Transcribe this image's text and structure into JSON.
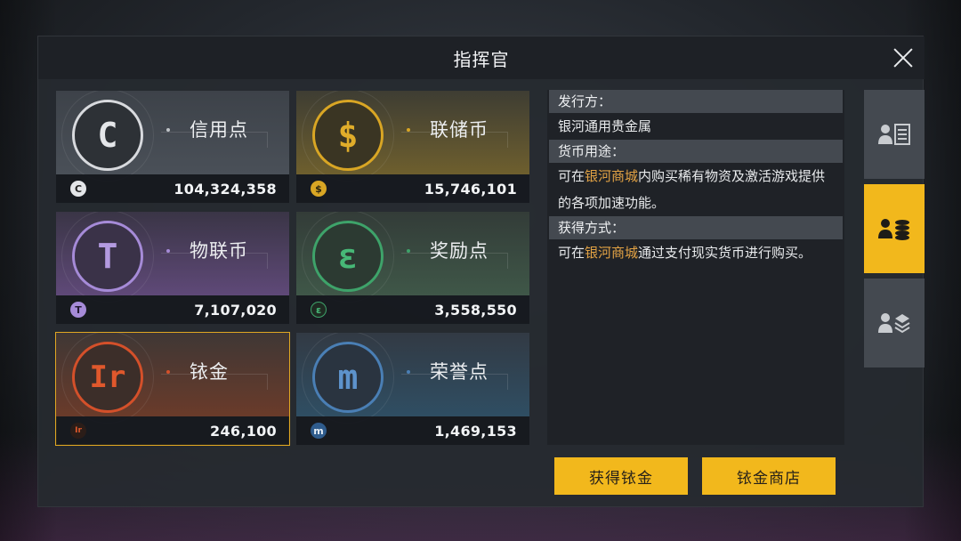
{
  "window": {
    "title": "指挥官"
  },
  "currencies": [
    {
      "name": "信用点",
      "amount": "104,324,358",
      "glyph": "C",
      "color": "#d8dade",
      "icon": "credit-icon"
    },
    {
      "name": "联储币",
      "amount": "15,746,101",
      "glyph": "$",
      "color": "#d9a624",
      "icon": "dollar-coin-icon"
    },
    {
      "name": "物联币",
      "amount": "7,107,020",
      "glyph": "T",
      "color": "#a68bd8",
      "icon": "iot-coin-icon"
    },
    {
      "name": "奖励点",
      "amount": "3,558,550",
      "glyph": "ε",
      "color": "#3ea36a",
      "icon": "reward-point-icon"
    },
    {
      "name": "铱金",
      "amount": "246,100",
      "glyph": "Ir",
      "color": "#d4502a",
      "icon": "iridium-icon",
      "selected": true
    },
    {
      "name": "荣誉点",
      "amount": "1,469,153",
      "glyph": "m",
      "color": "#4a7fb5",
      "icon": "honor-point-icon"
    }
  ],
  "info": {
    "issuer_label": "发行方：",
    "issuer_value": "银河通用贵金属",
    "usage_label": "货币用途：",
    "usage_prefix": "可在",
    "usage_link": "银河商城",
    "usage_suffix": "内购买稀有物资及激活游戏提供的各项加速功能。",
    "obtain_label": "获得方式：",
    "obtain_prefix": "可在",
    "obtain_link": "银河商城",
    "obtain_suffix": "通过支付现实货币进行购买。"
  },
  "tabs": [
    {
      "icon": "profile-list-icon",
      "active": false
    },
    {
      "icon": "profile-currency-icon",
      "active": true
    },
    {
      "icon": "profile-layers-icon",
      "active": false
    }
  ],
  "buttons": {
    "obtain": "获得铱金",
    "shop": "铱金商店"
  },
  "colors": {
    "accent": "#f2b81c",
    "highlight": "#e2a244"
  }
}
